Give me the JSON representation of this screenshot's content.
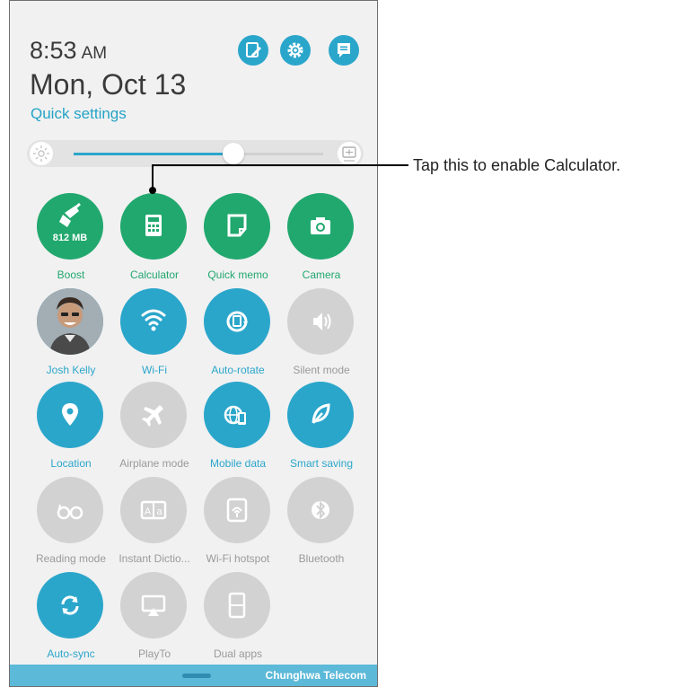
{
  "header": {
    "time": "8:53",
    "ampm": "AM",
    "date": "Mon, Oct 13",
    "quick_settings_label": "Quick settings",
    "buttons": [
      {
        "name": "edit-icon"
      },
      {
        "name": "settings-icon"
      },
      {
        "name": "message-icon"
      }
    ]
  },
  "brightness": {
    "level": 0.64,
    "left_icon": "brightness-icon",
    "right_icon": "auto-brightness-icon"
  },
  "tiles": [
    {
      "label": "Boost",
      "sublabel": "812 MB",
      "color": "green",
      "icon": "boost-broom-icon"
    },
    {
      "label": "Calculator",
      "color": "green",
      "icon": "calculator-icon"
    },
    {
      "label": "Quick memo",
      "color": "green",
      "icon": "memo-icon"
    },
    {
      "label": "Camera",
      "color": "green",
      "icon": "camera-icon"
    },
    {
      "label": "Josh Kelly",
      "color": "blue",
      "icon": "contact-photo"
    },
    {
      "label": "Wi-Fi",
      "color": "blue",
      "icon": "wifi-icon"
    },
    {
      "label": "Auto-rotate",
      "color": "blue",
      "icon": "auto-rotate-icon"
    },
    {
      "label": "Silent mode",
      "color": "gray",
      "icon": "silent-mode-icon"
    },
    {
      "label": "Location",
      "color": "blue",
      "icon": "location-pin-icon"
    },
    {
      "label": "Airplane mode",
      "color": "gray",
      "icon": "airplane-icon"
    },
    {
      "label": "Mobile data",
      "color": "blue",
      "icon": "mobile-data-icon"
    },
    {
      "label": "Smart saving",
      "color": "blue",
      "icon": "leaf-icon"
    },
    {
      "label": "Reading mode",
      "color": "gray",
      "icon": "glasses-icon"
    },
    {
      "label": "Instant Dictio...",
      "color": "gray",
      "icon": "dictionary-icon"
    },
    {
      "label": "Wi-Fi hotspot",
      "color": "gray",
      "icon": "hotspot-icon"
    },
    {
      "label": "Bluetooth",
      "color": "gray",
      "icon": "bluetooth-icon"
    },
    {
      "label": "Auto-sync",
      "color": "blue",
      "icon": "sync-icon"
    },
    {
      "label": "PlayTo",
      "color": "gray",
      "icon": "playto-icon"
    },
    {
      "label": "Dual apps",
      "color": "gray",
      "icon": "dual-apps-icon"
    }
  ],
  "bottom_bar": {
    "carrier": "Chunghwa Telecom"
  },
  "callout": {
    "text": "Tap this to enable Calculator."
  },
  "colors": {
    "green": "#21a86e",
    "blue": "#2ba6cb",
    "gray": "#d2d2d2"
  }
}
